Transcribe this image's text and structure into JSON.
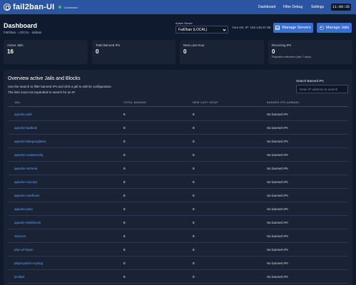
{
  "app": {
    "name": "fail2ban-UI",
    "status": "Connected"
  },
  "nav": {
    "items": [
      "Dashboard",
      "Filter Debug",
      "Settings"
    ],
    "clock": "11:09:35"
  },
  "header": {
    "title": "Dashboard",
    "subtitle": "Fail2ban - LOCAL - debian",
    "server_label": "Active Server",
    "server_selected": "Fail2ban (LOCAL)",
    "ext_ip": "Your ext. IP: 152.145.57.85",
    "manage_servers": "Manage Servers",
    "manage_jails": "Manage Jails"
  },
  "stats": [
    {
      "label": "Active Jails",
      "value": "16",
      "note": ""
    },
    {
      "label": "Total Banned IPs",
      "value": "0",
      "note": ""
    },
    {
      "label": "New Last Hour",
      "value": "0",
      "note": ""
    },
    {
      "label": "Recurring IPs",
      "value": "0",
      "note": "Repeated offenders (last 7 days)"
    }
  ],
  "overview": {
    "title": "Overview active Jails and Blocks",
    "desc1": "Use the search to filter banned IPs and click a jail to edit its configuration.",
    "desc2": "The lists must not expanded to search for an IP.",
    "search_label": "Search Banned IPs",
    "search_placeholder": "Enter IP address to search",
    "columns": [
      "JAIL",
      "TOTAL BANNED",
      "NEW LAST HOUR",
      "BANNED IPS (UNBAN)"
    ],
    "rows": [
      {
        "jail": "apache-auth",
        "total": "0",
        "new": "0",
        "banned": "No banned IPs"
      },
      {
        "jail": "apache-badbots",
        "total": "0",
        "new": "0",
        "banned": "No banned IPs"
      },
      {
        "jail": "apache-fakegooglebot",
        "total": "0",
        "new": "0",
        "banned": "No banned IPs"
      },
      {
        "jail": "apache-modsecurity",
        "total": "0",
        "new": "0",
        "banned": "No banned IPs"
      },
      {
        "jail": "apache-nohome",
        "total": "0",
        "new": "0",
        "banned": "No banned IPs"
      },
      {
        "jail": "apache-noscript",
        "total": "0",
        "new": "0",
        "banned": "No banned IPs"
      },
      {
        "jail": "apache-overflows",
        "total": "0",
        "new": "0",
        "banned": "No banned IPs"
      },
      {
        "jail": "apache-pass",
        "total": "0",
        "new": "0",
        "banned": "No banned IPs"
      },
      {
        "jail": "apache-shellshock",
        "total": "0",
        "new": "0",
        "banned": "No banned IPs"
      },
      {
        "jail": "dovecot",
        "total": "0",
        "new": "0",
        "banned": "No banned IPs"
      },
      {
        "jail": "php-url-fopen",
        "total": "0",
        "new": "0",
        "banned": "No banned IPs"
      },
      {
        "jail": "phpmyadmin-syslog",
        "total": "0",
        "new": "0",
        "banned": "No banned IPs"
      },
      {
        "jail": "proftpd",
        "total": "0",
        "new": "0",
        "banned": "No banned IPs"
      }
    ]
  }
}
